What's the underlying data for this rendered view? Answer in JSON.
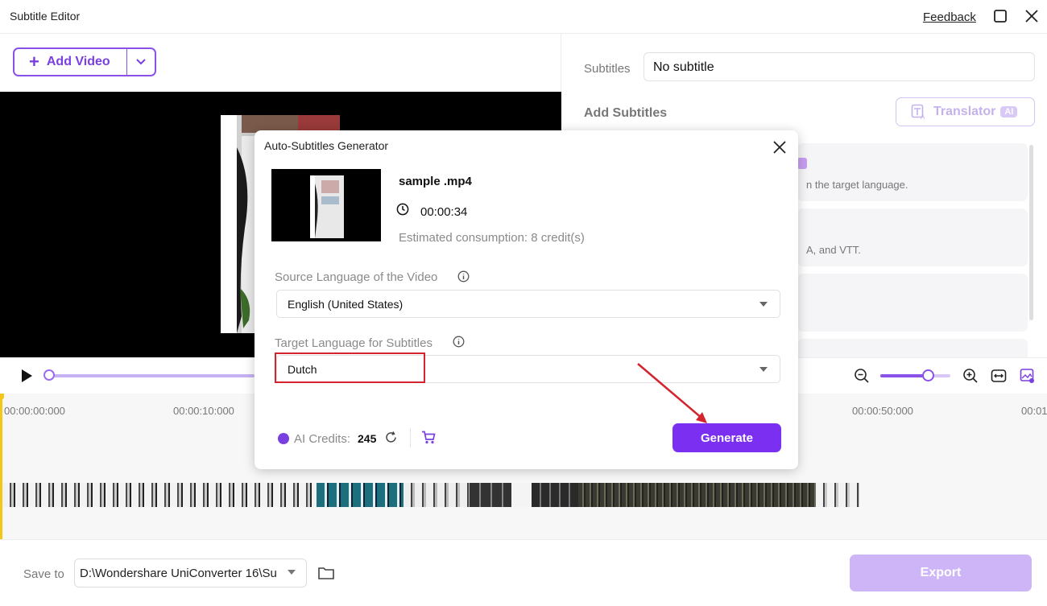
{
  "window": {
    "title": "Subtitle Editor",
    "feedback_label": "Feedback"
  },
  "toolbar": {
    "add_video_label": "Add Video"
  },
  "subtitles_panel": {
    "subtitles_label": "Subtitles",
    "subtitles_value": "No subtitle",
    "add_subtitles_heading": "Add Subtitles",
    "translator_label": "Translator",
    "translator_badge": "AI",
    "card_texts": [
      "n the target language.",
      "A, and VTT."
    ]
  },
  "timeline": {
    "ticks": [
      "00:00:00:000",
      "00:00:10:000",
      "00:00:50:000",
      "00:01"
    ]
  },
  "bottom": {
    "save_to_label": "Save to",
    "save_path": "D:\\Wondershare UniConverter 16\\Su",
    "export_label": "Export"
  },
  "dialog": {
    "title": "Auto-Subtitles Generator",
    "file_name": "sample .mp4",
    "duration": "00:00:34",
    "estimated": "Estimated consumption: 8 credit(s)",
    "source_label": "Source Language of the Video",
    "source_value": "English (United States)",
    "target_label": "Target Language for Subtitles",
    "target_value": "Dutch",
    "credits_label": "AI Credits:",
    "credits_value": "245",
    "generate_label": "Generate"
  },
  "colors": {
    "accent": "#7b2ff0",
    "accent_light": "#cdb5f7",
    "highlight_red": "#d4242e",
    "playhead": "#f5c518"
  }
}
